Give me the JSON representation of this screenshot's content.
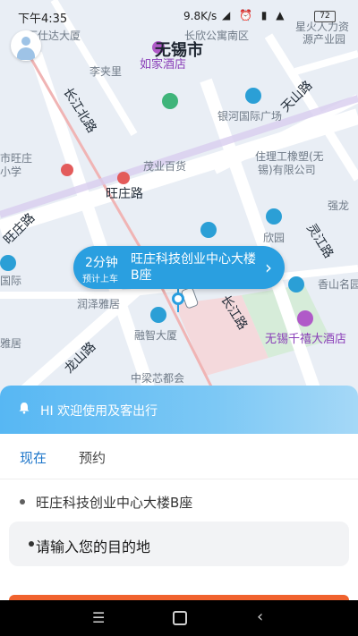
{
  "status_bar": {
    "time": "下午4:35",
    "network_speed": "9.8K/s",
    "battery": "72"
  },
  "map": {
    "city": "无锡市",
    "labels": {
      "shida": "下仕达大厦",
      "changfa": "长欣公寓南区",
      "xinghuo": "星火人力资",
      "chanyeyuan": "源产业园",
      "rujia": "如家酒店",
      "lijiali": "李夹里",
      "changjiang_north": "长江北路",
      "tianshan": "天山路",
      "yinhe": "银河国际广场",
      "shiwangzhuang": "市旺庄",
      "xiaoxue": "小学",
      "maoye": "茂业百货",
      "wangzhuang_rd": "旺庄路",
      "zhuli": "住理工橡塑(无",
      "zhuli2": "锡)有限公司",
      "qianglong": "强龙",
      "xinyuan": "欣园",
      "lingjiang": "灵江路",
      "changjiang_rd": "长江路",
      "xiangshan": "香山名园",
      "runze": "润泽雅居",
      "guoji": "国际",
      "rongzhi": "融智大厦",
      "wuxi_hotel": "无锡千禧大酒店",
      "yaju": "雅居",
      "longshan": "龙山路",
      "zhongliang": "中梁芯都会",
      "wangzhuang_road_left": "旺庄路"
    },
    "pickup_bubble": {
      "eta": "2分钟",
      "eta_sub": "预计上车",
      "address": "旺庄科技创业中心大楼B座"
    }
  },
  "panel": {
    "banner_message": "HI 欢迎使用及客出行",
    "tabs": [
      "现在",
      "预约"
    ],
    "pickup_location": "旺庄科技创业中心大楼B座",
    "destination_placeholder": "请输入您的目的地"
  },
  "colors": {
    "accent": "#2a9fe0",
    "tab_active": "#1a74c9",
    "orange": "#f0622e"
  }
}
